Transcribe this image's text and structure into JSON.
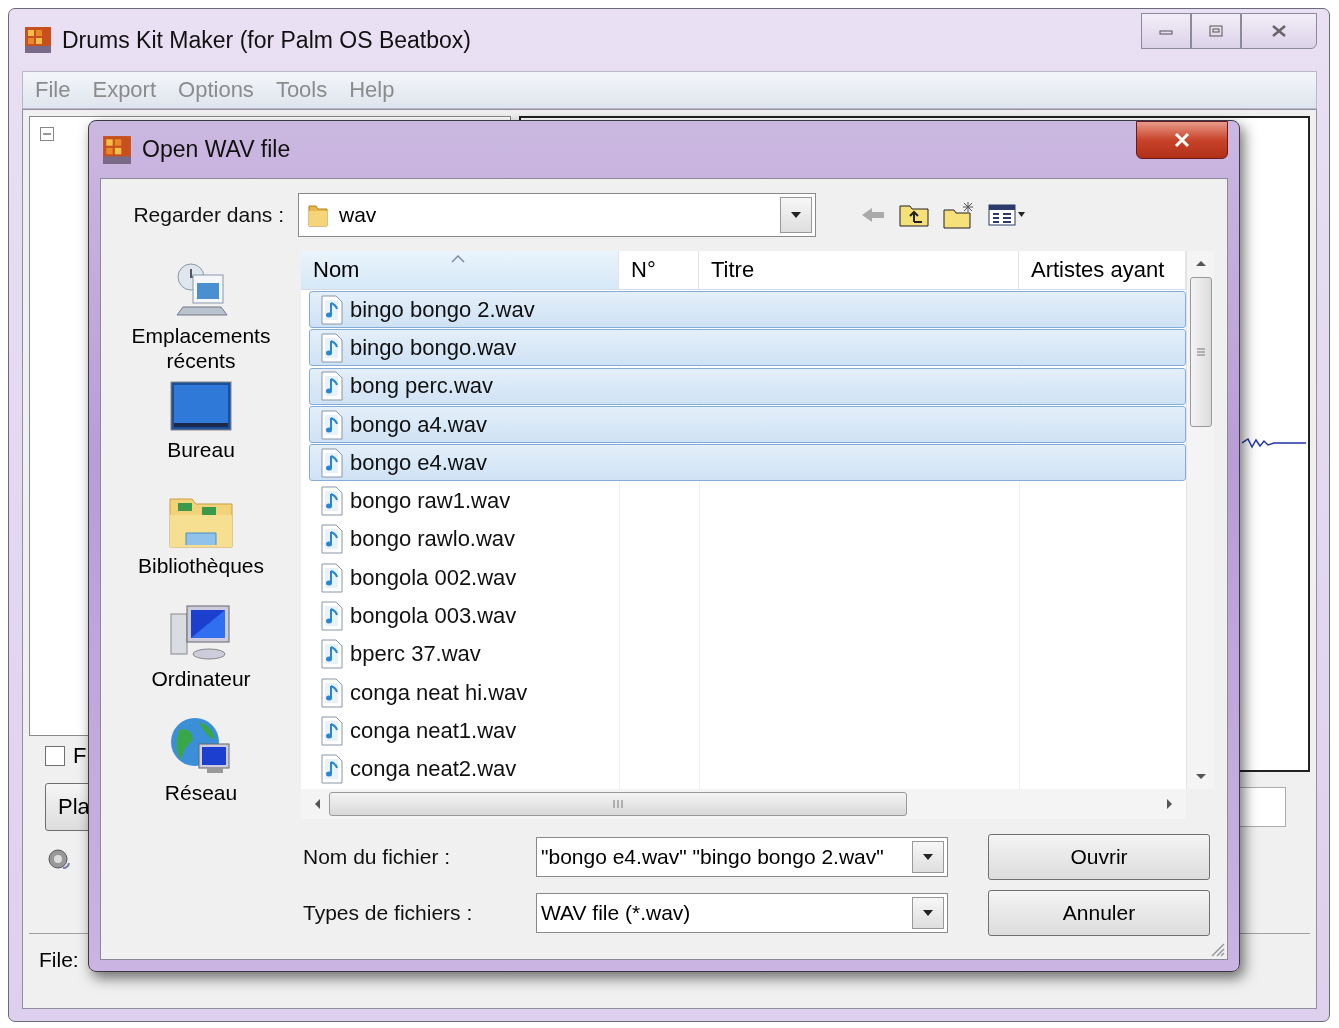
{
  "app": {
    "title": "Drums Kit Maker (for Palm OS Beatbox)",
    "menu": [
      "File",
      "Export",
      "Options",
      "Tools",
      "Help"
    ],
    "option_checkbox": {
      "label": "F",
      "checked": false
    },
    "play_button": "Pla",
    "status_label": "File:"
  },
  "dialog": {
    "title": "Open WAV file",
    "look_in": {
      "label": "Regarder dans :",
      "value": "wav"
    },
    "places": [
      {
        "kind": "recent",
        "label": "Emplacements récents"
      },
      {
        "kind": "desktop",
        "label": "Bureau"
      },
      {
        "kind": "libraries",
        "label": "Bibliothèques"
      },
      {
        "kind": "computer",
        "label": "Ordinateur"
      },
      {
        "kind": "network",
        "label": "Réseau"
      }
    ],
    "columns": [
      "Nom",
      "N°",
      "Titre",
      "Artistes ayant"
    ],
    "files": [
      {
        "name": "bingo bongo 2.wav",
        "selected": true
      },
      {
        "name": "bingo bongo.wav",
        "selected": true
      },
      {
        "name": "bong perc.wav",
        "selected": true
      },
      {
        "name": "bongo a4.wav",
        "selected": true
      },
      {
        "name": "bongo e4.wav",
        "selected": true
      },
      {
        "name": "bongo raw1.wav",
        "selected": false
      },
      {
        "name": "bongo rawlo.wav",
        "selected": false
      },
      {
        "name": "bongola 002.wav",
        "selected": false
      },
      {
        "name": "bongola 003.wav",
        "selected": false
      },
      {
        "name": "bperc 37.wav",
        "selected": false
      },
      {
        "name": "conga neat hi.wav",
        "selected": false
      },
      {
        "name": "conga neat1.wav",
        "selected": false
      },
      {
        "name": "conga neat2.wav",
        "selected": false
      }
    ],
    "file_name": {
      "label": "Nom du fichier :",
      "value": "\"bongo e4.wav\" \"bingo bongo 2.wav\""
    },
    "file_type": {
      "label": "Types de fichiers :",
      "value": "WAV file (*.wav)"
    },
    "buttons": [
      "Ouvrir",
      "Annuler"
    ]
  }
}
